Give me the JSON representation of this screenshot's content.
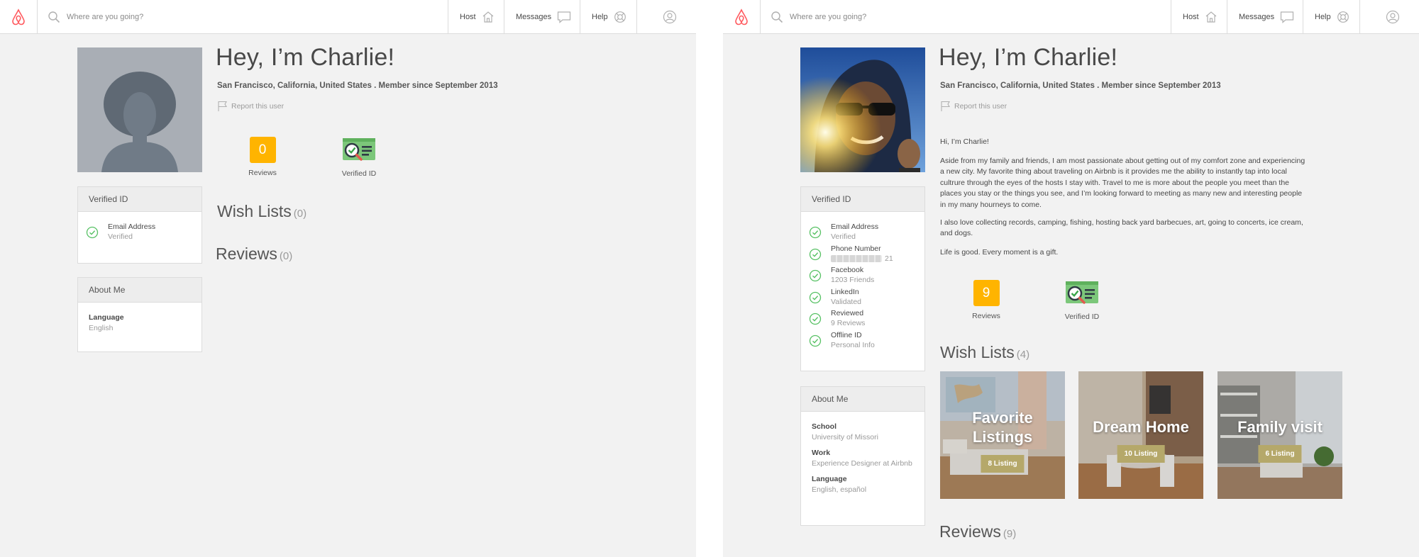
{
  "colors": {
    "brand": "#ff5a5f",
    "accent_yellow": "#ffb400",
    "verified_green": "#57c164",
    "wishlist_tag": "#b5a86a"
  },
  "nav": {
    "search_placeholder": "Where are you going?",
    "host": "Host",
    "messages": "Messages",
    "help": "Help",
    "icons": [
      "airbnb-logo-icon",
      "search-icon",
      "house-icon",
      "message-icon",
      "help-lifebuoy-icon",
      "user-icon"
    ]
  },
  "left": {
    "title": "Hey, I’m Charlie!",
    "subline": "San Francisco, California, United States . Member since September 2013",
    "report": "Report this user",
    "verified": {
      "header": "Verified ID",
      "items": [
        {
          "label": "Email Address",
          "sub": "Verified"
        }
      ]
    },
    "about": {
      "header": "About Me",
      "items": [
        {
          "label": "Language",
          "value": "English"
        }
      ]
    },
    "badges": {
      "reviews_count": "0",
      "reviews_label": "Reviews",
      "verified_label": "Verified ID"
    },
    "wishlists": {
      "title": "Wish Lists",
      "count": "(0)"
    },
    "reviews": {
      "title": "Reviews",
      "count": "(0)"
    }
  },
  "right": {
    "title": "Hey, I’m Charlie!",
    "subline": "San Francisco, California, United States . Member since September 2013",
    "report": "Report this user",
    "bio": [
      "Hi, I’m Charlie!",
      "Aside from my family and friends, I am most passionate about getting out of my comfort zone and experiencing a new city. My favorite thing about traveling on Airbnb is it provides me the ability to instantly tap into local cultrure through the eyes of the hosts I stay with. Travel to me is more about the people you meet than the places you stay or the things you see, and I’m looking forward to meeting as many new and interesting people in my many hourneys to  come.",
      "I also love collecting records, camping, fishing, hosting back yard barbecues, art, going to concerts, ice cream, and dogs.",
      "Life is good. Every moment is a gift."
    ],
    "verified": {
      "header": "Verified ID",
      "items": [
        {
          "label": "Email Address",
          "sub": "Verified"
        },
        {
          "label": "Phone Number",
          "sub": "21"
        },
        {
          "label": "Facebook",
          "sub": "1203 Friends"
        },
        {
          "label": "LinkedIn",
          "sub": "Validated"
        },
        {
          "label": "Reviewed",
          "sub": "9 Reviews"
        },
        {
          "label": "Offline ID",
          "sub": "Personal Info"
        }
      ]
    },
    "about": {
      "header": "About Me",
      "items": [
        {
          "label": "School",
          "value": "University of Missori"
        },
        {
          "label": "Work",
          "value": "Experience Designer at Airbnb"
        },
        {
          "label": "Language",
          "value": "English, español"
        }
      ]
    },
    "badges": {
      "reviews_count": "9",
      "reviews_label": "Reviews",
      "verified_label": "Verified ID"
    },
    "wishlists": {
      "title": "Wish Lists",
      "count": "(4)",
      "cards": [
        {
          "name": "Favorite Listings",
          "count": "8 Listing"
        },
        {
          "name": "Dream Home",
          "count": "10 Listing"
        },
        {
          "name": "Family visit",
          "count": "6 Listing"
        }
      ]
    },
    "reviews": {
      "title": "Reviews",
      "count": "(9)"
    }
  }
}
